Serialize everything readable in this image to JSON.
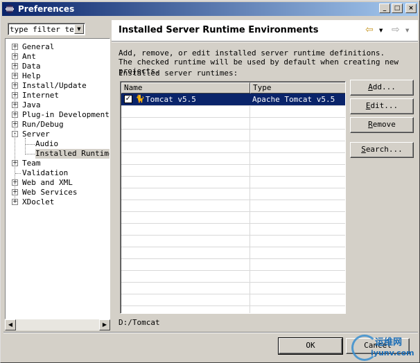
{
  "window": {
    "title": "Preferences",
    "controls": [
      "_",
      "□",
      "×"
    ]
  },
  "filter": {
    "value": "type filter text"
  },
  "tree": {
    "items": [
      {
        "label": "General",
        "expander": "+"
      },
      {
        "label": "Ant",
        "expander": "+"
      },
      {
        "label": "Data",
        "expander": "+"
      },
      {
        "label": "Help",
        "expander": "+"
      },
      {
        "label": "Install/Update",
        "expander": "+"
      },
      {
        "label": "Internet",
        "expander": "+"
      },
      {
        "label": "Java",
        "expander": "+"
      },
      {
        "label": "Plug-in Development",
        "expander": "+"
      },
      {
        "label": "Run/Debug",
        "expander": "+"
      },
      {
        "label": "Server",
        "expander": "-"
      },
      {
        "label": "Audio",
        "expander": ""
      },
      {
        "label": "Installed Runtime",
        "expander": "",
        "selected": true
      },
      {
        "label": "Team",
        "expander": "+"
      },
      {
        "label": "Validation",
        "expander": ""
      },
      {
        "label": "Web and XML",
        "expander": "+"
      },
      {
        "label": "Web Services",
        "expander": "+"
      },
      {
        "label": "XDoclet",
        "expander": "+"
      }
    ]
  },
  "page": {
    "title": "Installed Server Runtime Environments",
    "description_line1": "Add, remove, or edit installed server runtime definitions.",
    "description_line2": "The checked runtime will be used by default when creating new projects.",
    "list_label": "Installed server runtimes:",
    "columns": [
      "Name",
      "Type"
    ],
    "runtimes": [
      {
        "name": "Tomcat v5.5",
        "type": "Apache Tomcat v5.5",
        "checked": "✓",
        "selected": true
      }
    ],
    "path": "D:/Tomcat"
  },
  "buttons": {
    "add": {
      "u": "A",
      "rest": "dd..."
    },
    "edit": {
      "u": "E",
      "rest": "dit..."
    },
    "remove": {
      "u": "R",
      "rest": "emove"
    },
    "search": {
      "u": "S",
      "rest": "earch..."
    }
  },
  "dialog": {
    "ok": "OK",
    "cancel": "Cancel"
  },
  "watermark": {
    "line1": "运维网",
    "line2": "iyunv.com"
  },
  "colors": {
    "title_gradient_start": "#0a246a",
    "title_gradient_end": "#a6caf0",
    "selection": "#0a246a",
    "face": "#d4d0c8"
  }
}
